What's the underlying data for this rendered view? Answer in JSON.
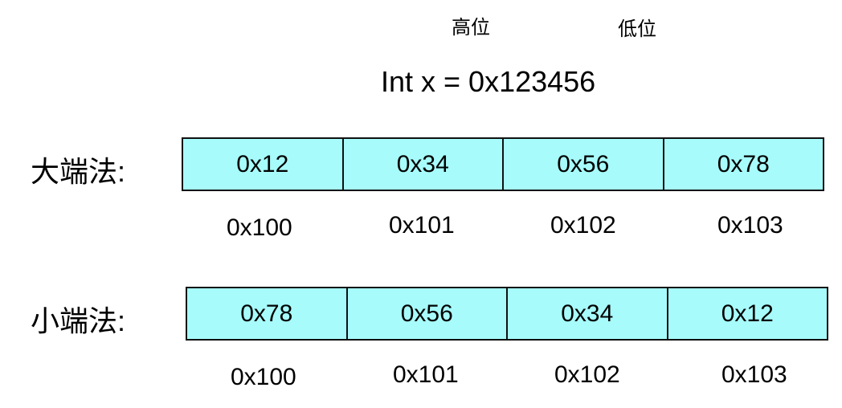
{
  "markers": {
    "high": "高位",
    "low": "低位"
  },
  "expression": "Int x = 0x123456",
  "big_endian": {
    "label": "大端法:",
    "bytes": [
      "0x12",
      "0x34",
      "0x56",
      "0x78"
    ],
    "addresses": [
      "0x100",
      "0x101",
      "0x102",
      "0x103"
    ]
  },
  "little_endian": {
    "label": "小端法:",
    "bytes": [
      "0x78",
      "0x56",
      "0x34",
      "0x12"
    ],
    "addresses": [
      "0x100",
      "0x101",
      "0x102",
      "0x103"
    ]
  },
  "colors": {
    "cell_fill": "#a7fbfb",
    "border": "#111111",
    "text": "#000000"
  }
}
